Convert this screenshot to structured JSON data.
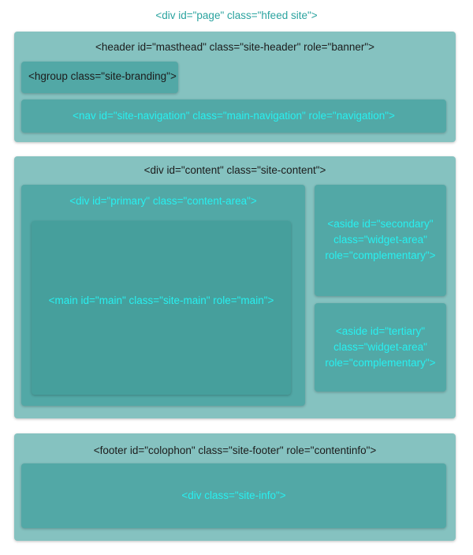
{
  "page_label": "<div id=\"page\" class=\"hfeed site\">",
  "header": {
    "label": "<header id=\"masthead\" class=\"site-header\" role=\"banner\">",
    "hgroup_label": "<hgroup class=\"site-branding\">",
    "nav_label": "<nav id=\"site-navigation\" class=\"main-navigation\" role=\"navigation\">"
  },
  "content": {
    "label": "<div id=\"content\" class=\"site-content\">",
    "primary_label": "<div id=\"primary\" class=\"content-area\">",
    "main_label": "<main id=\"main\" class=\"site-main\" role=\"main\">",
    "secondary_lines": [
      "<aside id=\"secondary\"",
      "class=\"widget-area\"",
      "role=\"complementary\">"
    ],
    "tertiary_lines": [
      "<aside id=\"tertiary\"",
      "class=\"widget-area\"",
      "role=\"complementary\">"
    ]
  },
  "footer": {
    "label": "<footer id=\"colophon\" class=\"site-footer\" role=\"contentinfo\">",
    "siteinfo_label": "<div class=\"site-info\">"
  },
  "colors": {
    "outer": "#85c2c0",
    "inner": "#52a8a6",
    "label_dark": "#1c1c1c",
    "label_cyan": "#28f0f0",
    "label_teal": "#2aa39f"
  }
}
